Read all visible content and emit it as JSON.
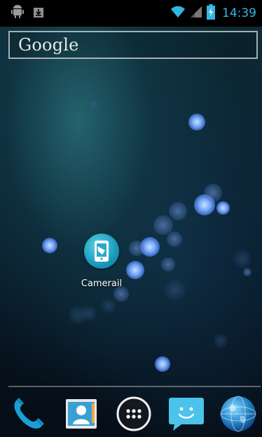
{
  "status_bar": {
    "time": "14:39",
    "left_icons": [
      "android-debug-icon",
      "download-icon"
    ],
    "right_icons": [
      "wifi-icon",
      "signal-icon",
      "battery-charging-icon"
    ],
    "accent_color": "#33b5e5"
  },
  "search_bar": {
    "logo_text": "Google"
  },
  "home_screen": {
    "apps": [
      {
        "label": "Camerail",
        "icon": "camerail-app-icon"
      }
    ]
  },
  "dock": {
    "items": [
      {
        "icon": "phone-icon"
      },
      {
        "icon": "contacts-icon"
      },
      {
        "icon": "app-drawer-icon"
      },
      {
        "icon": "messaging-icon"
      },
      {
        "icon": "browser-globe-icon"
      }
    ]
  }
}
